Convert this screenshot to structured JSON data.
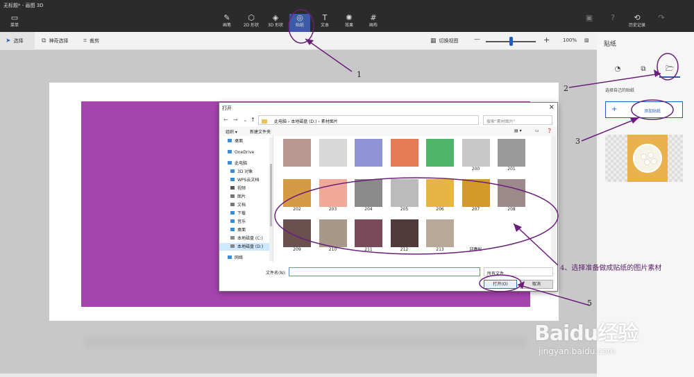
{
  "app": {
    "title": "无标题* - 画图 3D"
  },
  "top_toolbar": {
    "menu": "菜单",
    "tools": [
      "画笔",
      "2D 形状",
      "3D 形状",
      "贴纸",
      "文本",
      "效果",
      "画布"
    ],
    "active_tool": "贴纸",
    "history": "历史记录"
  },
  "secondary_toolbar": {
    "select": "选择",
    "magic_select": "神奇选择",
    "crop": "裁剪",
    "switch_view": "切换视图",
    "zoom": "100%",
    "zoom_minus": "—",
    "zoom_plus": "+"
  },
  "right_panel": {
    "title": "贴纸",
    "subtitle": "选择自己的贴纸",
    "add_sticker": "添加贴纸",
    "add_plus": "+"
  },
  "dialog": {
    "title": "打开",
    "close": "×",
    "address": [
      "此电脑",
      "本地磁盘 (D:)",
      "素材图片"
    ],
    "search_placeholder": "搜索\"素材图片\"",
    "organize": "组织 ▾",
    "new_folder": "新建文件夹",
    "nav_items": [
      "桌面",
      "OneDrive",
      "此电脑",
      "3D 对象",
      "WPS云文档",
      "视频",
      "图片",
      "文档",
      "下载",
      "音乐",
      "桌面",
      "本地磁盘 (C:)",
      "本地磁盘 (D:)",
      "网络"
    ],
    "selected_nav": "本地磁盘 (D:)",
    "files": [
      {
        "label": "",
        "color": "#b89a90"
      },
      {
        "label": "",
        "color": "#d8d8d8"
      },
      {
        "label": "",
        "color": "#8f95d4"
      },
      {
        "label": "",
        "color": "#e57a54"
      },
      {
        "label": "",
        "color": "#4fb56a"
      },
      {
        "label": "200",
        "color": "#c8c8c8"
      },
      {
        "label": "201",
        "color": "#9a9a9a"
      },
      {
        "label": "202",
        "color": "#d59a45"
      },
      {
        "label": "203",
        "color": "#f0a898"
      },
      {
        "label": "204",
        "color": "#8a8a8a"
      },
      {
        "label": "205",
        "color": "#bbbbbb"
      },
      {
        "label": "206",
        "color": "#e7b545"
      },
      {
        "label": "207",
        "color": "#d39a2a"
      },
      {
        "label": "208",
        "color": "#9c8a8a"
      },
      {
        "label": "209",
        "color": "#6b5050"
      },
      {
        "label": "210",
        "color": "#a89888"
      },
      {
        "label": "211",
        "color": "#7a4a5a"
      },
      {
        "label": "212",
        "color": "#503a3a"
      },
      {
        "label": "213",
        "color": "#b8a898"
      },
      {
        "label": "迎春松",
        "color": "#ffffff"
      }
    ],
    "filename_label": "文件名(N):",
    "filetype": "所有文件",
    "open": "打开(O)",
    "cancel": "取消"
  },
  "annotations": {
    "n1": "1",
    "n2": "2",
    "n3": "3",
    "n5": "5",
    "step4": "4、选择准备做成贴纸的图片素材"
  },
  "watermark": {
    "logo": "Baidu经验",
    "url": "jingyan.baidu.com"
  }
}
